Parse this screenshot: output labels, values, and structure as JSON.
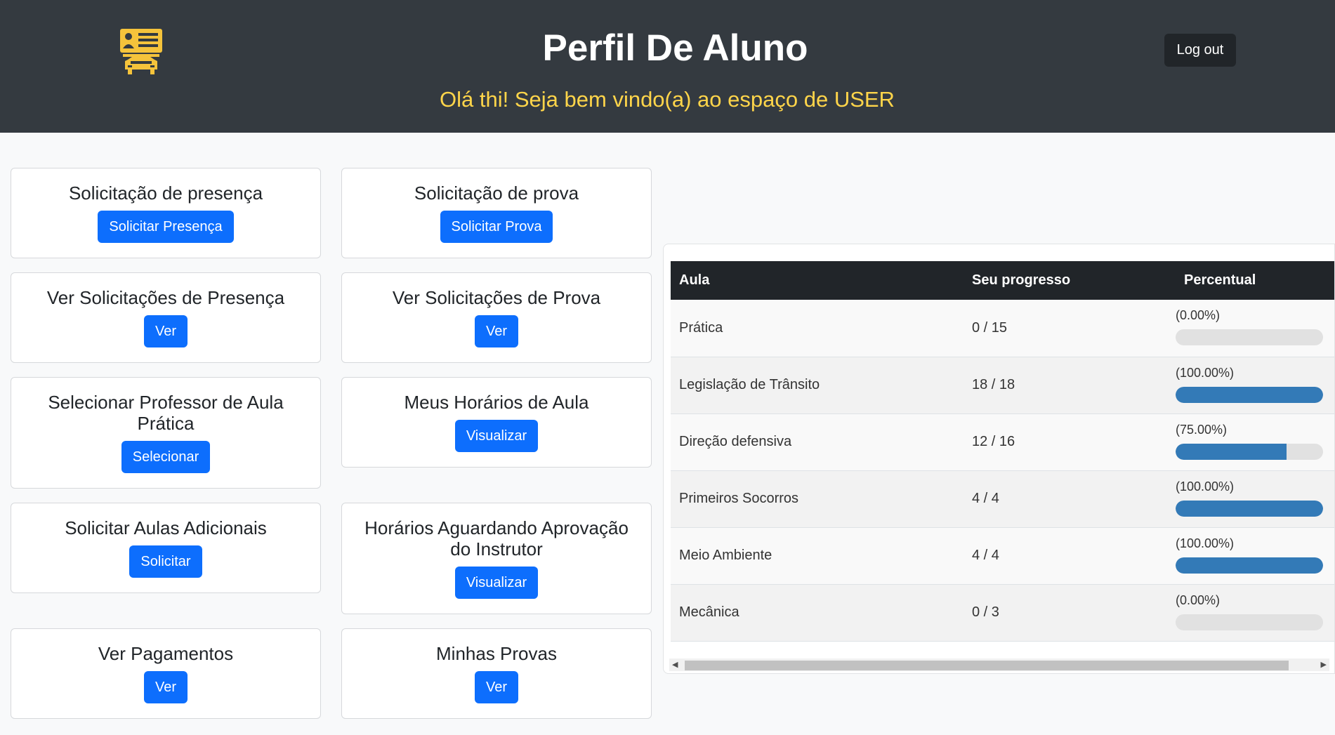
{
  "header": {
    "title": "Perfil De Aluno",
    "welcome": "Olá thi! Seja bem vindo(a) ao espaço de USER",
    "logout_label": "Log out",
    "logo_icon": "student-id-car-icon"
  },
  "cards": {
    "solicitacao_presenca": {
      "title": "Solicitação de presença",
      "button": "Solicitar Presença"
    },
    "solicitacao_prova": {
      "title": "Solicitação de prova",
      "button": "Solicitar Prova"
    },
    "ver_sol_presenca": {
      "title": "Ver Solicitações de Presença",
      "button": "Ver"
    },
    "ver_sol_prova": {
      "title": "Ver Solicitações de Prova",
      "button": "Ver"
    },
    "selecionar_professor": {
      "title": "Selecionar Professor de Aula Prática",
      "button": "Selecionar"
    },
    "meus_horarios": {
      "title": "Meus Horários de Aula",
      "button": "Visualizar"
    },
    "aulas_adicionais": {
      "title": "Solicitar Aulas Adicionais",
      "button": "Solicitar"
    },
    "horarios_aguardando": {
      "title": "Horários Aguardando Aprovação do Instrutor",
      "button": "Visualizar"
    },
    "ver_pagamentos": {
      "title": "Ver Pagamentos",
      "button": "Ver"
    },
    "minhas_provas": {
      "title": "Minhas Provas",
      "button": "Ver"
    }
  },
  "progress_table": {
    "headers": [
      "Aula",
      "Seu progresso",
      "Percentual"
    ],
    "rows": [
      {
        "aula": "Prática",
        "progresso": "0 / 15",
        "percentual": "(0.00%)",
        "value": 0
      },
      {
        "aula": "Legislação de Trânsito",
        "progresso": "18 / 18",
        "percentual": "(100.00%)",
        "value": 100
      },
      {
        "aula": "Direção defensiva",
        "progresso": "12 / 16",
        "percentual": "(75.00%)",
        "value": 75
      },
      {
        "aula": "Primeiros Socorros",
        "progresso": "4 / 4",
        "percentual": "(100.00%)",
        "value": 100
      },
      {
        "aula": "Meio Ambiente",
        "progresso": "4 / 4",
        "percentual": "(100.00%)",
        "value": 100
      },
      {
        "aula": "Mecânica",
        "progresso": "0 / 3",
        "percentual": "(0.00%)",
        "value": 0
      }
    ]
  },
  "colors": {
    "header_bg": "#343a40",
    "welcome_text": "#ffd54a",
    "primary_button": "#0d6efd",
    "progress_fill": "#337ab7"
  }
}
